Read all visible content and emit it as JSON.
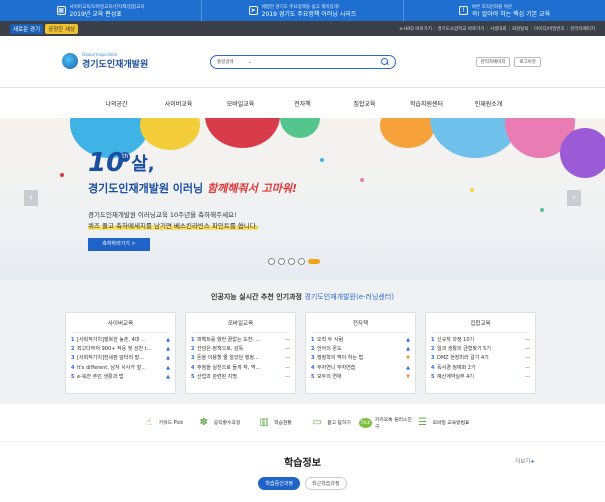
{
  "topbar": [
    {
      "l1": "사이버교육/모바일교육/전자책/집합교육",
      "l2": "2019년 교육 편성표",
      "icon": "calendar-icon"
    },
    {
      "l1": "체험한 경기도 주요정책을 쉽고 재미있게!",
      "l2": "2019 경기도 주요정책 이러닝 시리즈",
      "icon": "send-icon"
    },
    {
      "l1": "바른 조직문화를 위한",
      "l2": "꼭! 알아야 하는 핵심 기본 교육",
      "icon": "info-icon"
    }
  ],
  "slogan": {
    "part1": "새로운 경기",
    "part2": "공정한 세상"
  },
  "utillinks": [
    "e-HRD 바로가기",
    "경기도소방학교 바로가기",
    "사생대회",
    "회원탈퇴",
    "아이디/비밀번호",
    "관리자페이지"
  ],
  "header": {
    "logo_sub": "Global Inspiration",
    "logo_main": "경기도인재개발원",
    "search_select": "통합검색",
    "btn_admin": "관리자페이지",
    "btn_logout": "로그아웃"
  },
  "gnb": [
    "나의공간",
    "사이버교육",
    "모바일교육",
    "전자책",
    "집합교육",
    "학습지원센터",
    "인재원소개"
  ],
  "hero": {
    "ten": "10",
    "th": "th",
    "sal": "살,",
    "headline": "경기도인재개발원 이러닝",
    "headline2": "함께해줘서 고마워!",
    "line1": "경기도인재개발원 이러닝교육 10주년을 축하해주세요!",
    "line2": "퀴즈 풀고 축하메세지를 남기면 베스킨라빈스 파인트를 쏩니다.",
    "cta": "축하하러가기 >",
    "prev": "‹",
    "next": "›"
  },
  "slider": {
    "count": 5,
    "active": 5
  },
  "popular": {
    "title": "인공지능 실시간 추천 인기과정",
    "accent": "경기도인재개발원(e-러닝센터)",
    "cards": [
      {
        "title": "사이버교육",
        "items": [
          {
            "n": "1",
            "t": "[사회적가치]행복한 농촌,  4대 ...",
            "trend": "up"
          },
          {
            "n": "2",
            "t": "최고다부처 900+ 적응 첫 성찬 t...",
            "trend": "up"
          },
          {
            "n": "3",
            "t": "[사회적가치]전세판 달터러 발...",
            "trend": "up"
          },
          {
            "n": "4",
            "t": "It's different, 남자 사사가 앞...",
            "trend": "up"
          },
          {
            "n": "5",
            "t": "e-북한 주민 생활과 법",
            "trend": "up"
          }
        ]
      },
      {
        "title": "모바일교육",
        "items": [
          {
            "n": "1",
            "t": "퍼펙트를 향한 끝없는 도전, ...",
            "trend": "same"
          },
          {
            "n": "2",
            "t": "선넘은 정책으로, 감독",
            "trend": "same"
          },
          {
            "n": "3",
            "t": "돈을 이용할 줄 알았던 행정...",
            "trend": "same"
          },
          {
            "n": "4",
            "t": "주정을 실천으로 들게 작, 먹...",
            "trend": "same"
          },
          {
            "n": "5",
            "t": "산업과 관련된 지명",
            "trend": "same"
          }
        ]
      },
      {
        "title": "전자책",
        "items": [
          {
            "n": "1",
            "t": "오직 두 사람",
            "trend": "up"
          },
          {
            "n": "2",
            "t": "언어의 온도",
            "trend": "up"
          },
          {
            "n": "3",
            "t": "행정학의 맥이 하는 법",
            "trend": "dn"
          },
          {
            "n": "4",
            "t": "부자연니 부자연습",
            "trend": "up"
          },
          {
            "n": "5",
            "t": "모두의 연애",
            "trend": "dn"
          }
        ]
      },
      {
        "title": "집합교육",
        "items": [
          {
            "n": "1",
            "t": "신규자 과정 10기",
            "trend": "same"
          },
          {
            "n": "2",
            "t": "일과 생활의 균형찾기 5기",
            "trend": "same"
          },
          {
            "n": "3",
            "t": "DMZ 현장미라 갈기 4기",
            "trend": "same"
          },
          {
            "n": "4",
            "t": "독서경 정예화 2기",
            "trend": "same"
          },
          {
            "n": "5",
            "t": "예산계약실무 4기",
            "trend": "same"
          }
        ]
      }
    ]
  },
  "trend_symbols": {
    "up": "▲",
    "dn": "▼",
    "same": "—"
  },
  "quick": [
    {
      "label": "키워드 Pick",
      "icon": "hand-icon"
    },
    {
      "label": "공직황수과정",
      "icon": "ribbon-icon"
    },
    {
      "label": "학습현황",
      "icon": "chart-icon"
    },
    {
      "label": "묻고 답하기",
      "icon": "chat-icon"
    },
    {
      "label": "카카오톡 플러스친구",
      "icon": "talk-icon"
    },
    {
      "label": "모바일 교육방법표",
      "icon": "list-icon"
    }
  ],
  "study": {
    "title": "학습정보",
    "more": "더보기",
    "tab1": "학습중인과정",
    "tab2": "최근학습과정"
  }
}
